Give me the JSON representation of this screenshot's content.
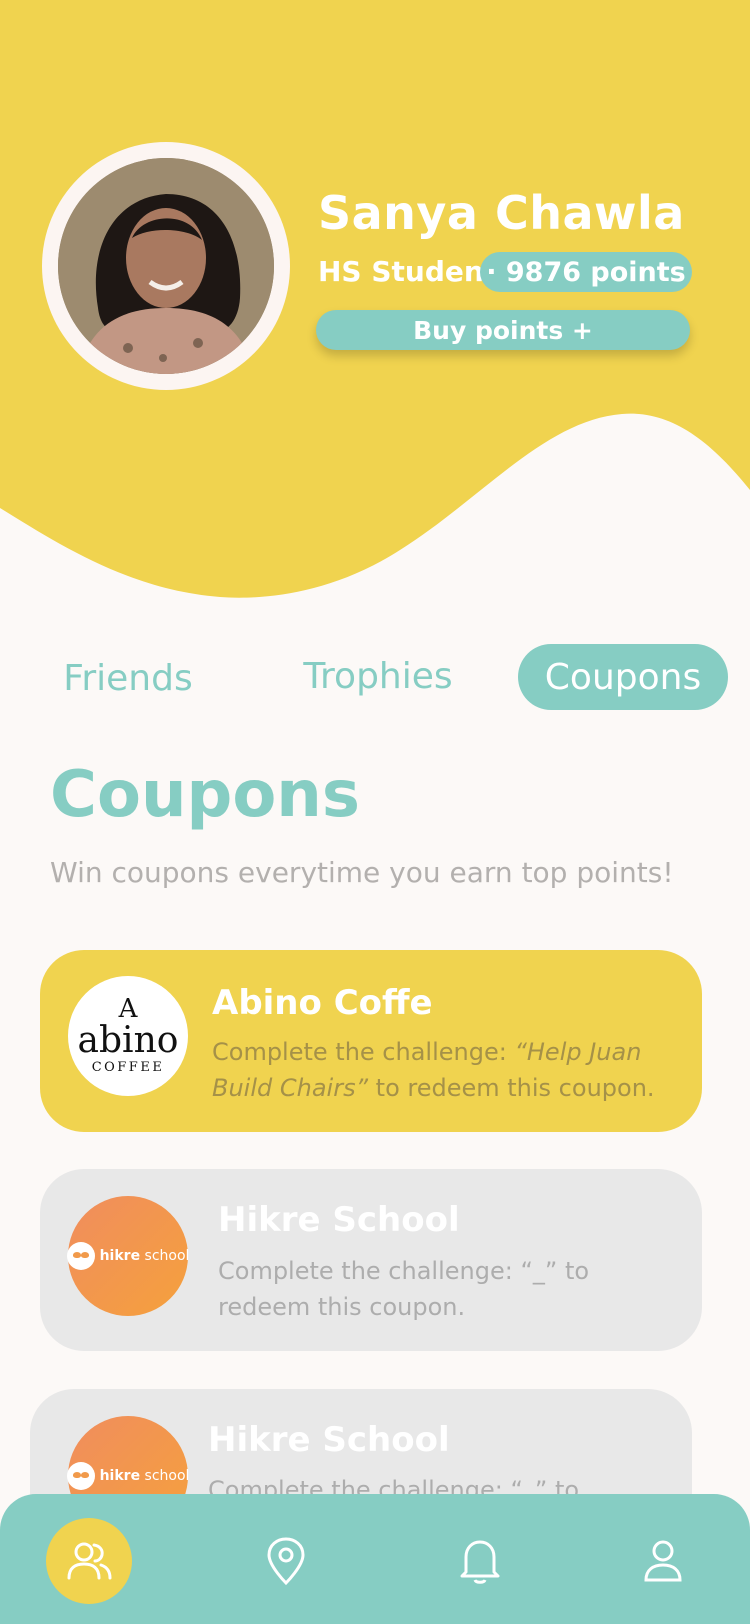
{
  "profile": {
    "name": "Sanya Chawla",
    "role": "HS Student",
    "points": "· 9876 points",
    "buy_label": "Buy points +"
  },
  "tabs": [
    {
      "label": "Friends",
      "active": false
    },
    {
      "label": "Trophies",
      "active": false
    },
    {
      "label": "Coupons",
      "active": true
    }
  ],
  "section": {
    "title": "Coupons",
    "subtitle": "Win coupons everytime you earn top points!"
  },
  "coupons": [
    {
      "brand": "Abino Coffe",
      "desc_prefix": "Complete the challenge: ",
      "challenge": "“Help Juan Build Chairs”",
      "desc_suffix": " to redeem this coupon.",
      "logo_top": "A",
      "logo_word": "abino",
      "logo_sub": "COFFEE",
      "state": "active"
    },
    {
      "brand": "Hikre School",
      "desc": "Complete the challenge: “_” to redeem this coupon.",
      "logo_bold": "hikre",
      "logo_rest": " school",
      "state": "locked"
    },
    {
      "brand": "Hikre School",
      "desc": "Complete the challenge: “_” to redeem this coupon.",
      "logo_bold": "hikre",
      "logo_rest": " school",
      "state": "locked"
    }
  ],
  "nav": [
    {
      "icon": "friends-icon",
      "active": true
    },
    {
      "icon": "map-pin-icon",
      "active": false
    },
    {
      "icon": "bell-icon",
      "active": false
    },
    {
      "icon": "user-icon",
      "active": false
    }
  ],
  "colors": {
    "yellow": "#F0D34F",
    "teal": "#86CDC3",
    "background": "#FCF9F7",
    "card_inactive": "#E8E8E8"
  }
}
